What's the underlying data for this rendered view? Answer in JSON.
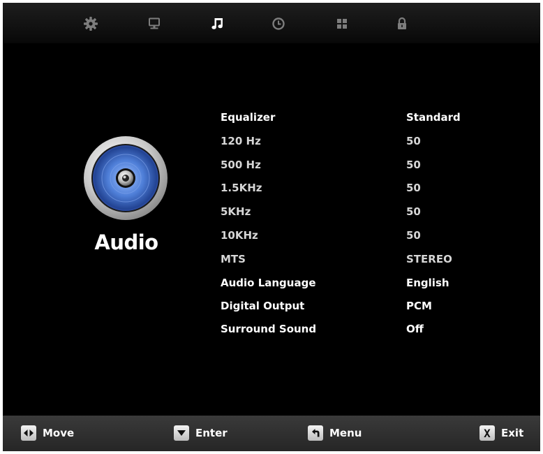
{
  "top_tabs": [
    {
      "icon": "gear-icon",
      "active": false
    },
    {
      "icon": "monitor-icon",
      "active": false
    },
    {
      "icon": "music-note-icon",
      "active": true
    },
    {
      "icon": "clock-icon",
      "active": false
    },
    {
      "icon": "grid-icon",
      "active": false
    },
    {
      "icon": "lock-icon",
      "active": false
    }
  ],
  "section": {
    "title": "Audio",
    "icon": "speaker-icon"
  },
  "menu": [
    {
      "label": "Equalizer",
      "value": "Standard"
    },
    {
      "label": "120 Hz",
      "value": "50"
    },
    {
      "label": "500 Hz",
      "value": "50"
    },
    {
      "label": "1.5KHz",
      "value": "50"
    },
    {
      "label": "5KHz",
      "value": "50"
    },
    {
      "label": "10KHz",
      "value": "50"
    },
    {
      "label": "MTS",
      "value": "STEREO"
    },
    {
      "label": "Audio Language",
      "value": "English"
    },
    {
      "label": "Digital Output",
      "value": "PCM"
    },
    {
      "label": "Surround Sound",
      "value": "Off"
    }
  ],
  "footer": {
    "move": {
      "key_icon": "left-right-arrows-icon",
      "label": "Move"
    },
    "enter": {
      "key_icon": "down-arrow-icon",
      "label": "Enter"
    },
    "menu": {
      "key_icon": "return-arrow-icon",
      "label": "Menu"
    },
    "exit": {
      "key_icon": "x-key-icon",
      "key_text": "X",
      "label": "Exit"
    }
  }
}
